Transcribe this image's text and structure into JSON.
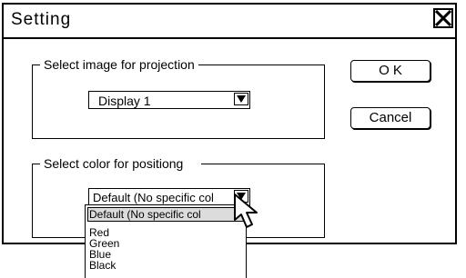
{
  "window": {
    "title": "Setting"
  },
  "group_image": {
    "label": "Select image for projection",
    "selected": "Display 1"
  },
  "group_color": {
    "label": "Select color for positiong",
    "selected": "Default (No specific col",
    "options": [
      "Default (No specific col",
      "Red",
      "Green",
      "Blue",
      "Black"
    ]
  },
  "buttons": {
    "ok": "O K",
    "cancel": "Cancel"
  }
}
